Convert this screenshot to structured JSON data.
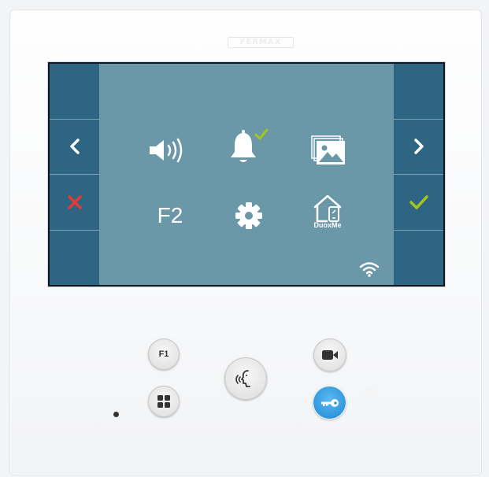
{
  "device": {
    "brand": "FERMAX"
  },
  "screen": {
    "left_column": [
      {
        "name": "empty-top",
        "icon": "none"
      },
      {
        "name": "back",
        "icon": "chevron-left-icon"
      },
      {
        "name": "cancel",
        "icon": "close-icon"
      },
      {
        "name": "empty-bottom",
        "icon": "none"
      }
    ],
    "right_column": [
      {
        "name": "empty-top",
        "icon": "none"
      },
      {
        "name": "forward",
        "icon": "chevron-right-icon"
      },
      {
        "name": "confirm",
        "icon": "checkmark-icon"
      },
      {
        "name": "empty-bottom",
        "icon": "none"
      }
    ],
    "menu": {
      "f2_label": "F2",
      "duoxme_label": "DuoxMe",
      "icons": [
        "speaker-volume-icon",
        "bell-icon",
        "gallery-icon",
        "f2-function",
        "gear-icon",
        "duoxme-home-icon"
      ],
      "bell_status": "active"
    },
    "status": {
      "wifi": "connected"
    }
  },
  "buttons": {
    "f1_label": "F1",
    "icons": [
      "f1-button",
      "menu-grid-icon",
      "voice-call-icon",
      "camera-icon",
      "key-icon"
    ]
  },
  "colors": {
    "screen_side": "#2e6583",
    "screen_center": "#6b98a8",
    "cancel_red": "#e53935",
    "confirm_green": "#a6c51c",
    "key_blue": "#2e96dc"
  }
}
